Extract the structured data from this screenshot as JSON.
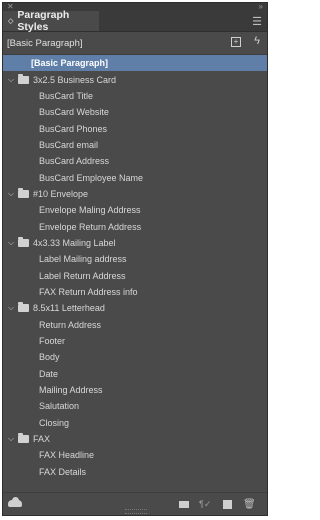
{
  "panel": {
    "tab_title": "Paragraph Styles",
    "current_style": "[Basic Paragraph]"
  },
  "list": {
    "selected": "[Basic Paragraph]",
    "groups": [
      {
        "name": "3x2.5 Business Card",
        "items": [
          "BusCard Title",
          "BusCard Website",
          "BusCard Phones",
          "BusCard email",
          "BusCard Address",
          "BusCard Employee Name"
        ]
      },
      {
        "name": "#10 Envelope",
        "items": [
          "Envelope Maling Address",
          "Envelope Return Address"
        ]
      },
      {
        "name": "4x3.33 Mailing Label",
        "items": [
          "Label Mailing address",
          "Label Return Address",
          "FAX Return Address info"
        ]
      },
      {
        "name": "8.5x11 Letterhead",
        "items": [
          "Return Address",
          "Footer",
          "Body",
          "Date",
          "Mailing Address",
          "Salutation",
          "Closing"
        ]
      },
      {
        "name": "FAX",
        "items": [
          "FAX Headline",
          "FAX Details"
        ]
      }
    ]
  },
  "icons": {
    "close": "close-icon",
    "collapse": "collapse-icon",
    "panel_menu": "panel-menu-icon",
    "twisty": "chevron-down-icon",
    "folder": "folder-icon",
    "cc_libraries": "cloud-icon",
    "new_group": "new-folder-icon",
    "clear_overrides": "clear-overrides-icon",
    "new_style": "new-style-icon",
    "delete": "trash-icon"
  },
  "colors": {
    "panel_bg": "#4a4a4a",
    "selection": "#5f7fa8"
  }
}
